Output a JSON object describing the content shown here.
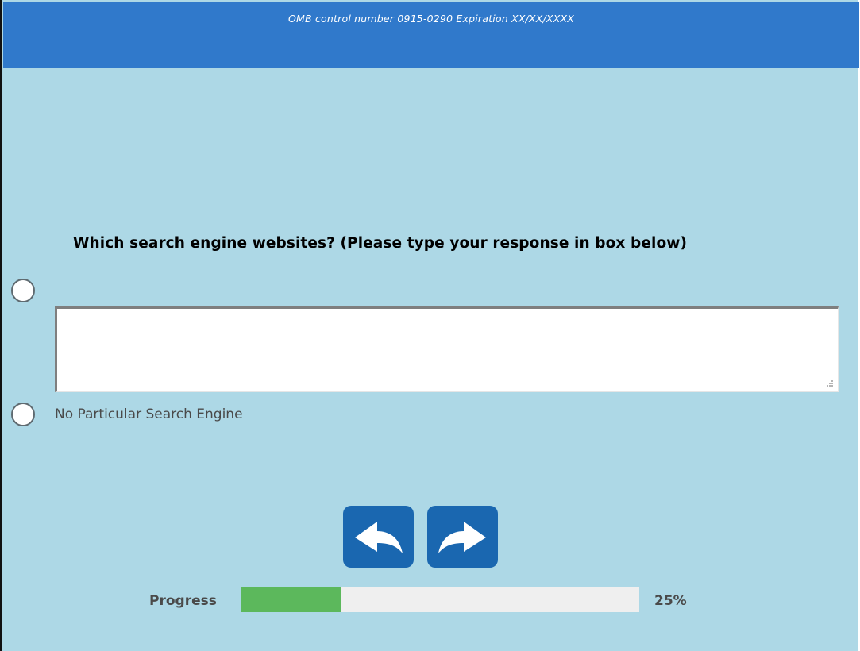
{
  "header": {
    "omb_text": "OMB control number 0915-0290 Expiration XX/XX/XXXX",
    "background_color": "#3079cb"
  },
  "question": {
    "text": "Which search engine websites? (Please type your response in box below)"
  },
  "options": [
    {
      "type": "radio-with-textbox",
      "selected": false,
      "textbox_value": "",
      "textbox_placeholder": ""
    },
    {
      "type": "radio",
      "label": "No Particular Search Engine",
      "selected": false
    }
  ],
  "navigation": {
    "back_icon": "back-arrow-icon",
    "next_icon": "forward-arrow-icon",
    "button_color": "#1a67b0"
  },
  "progress": {
    "label": "Progress",
    "percent_text": "25%",
    "fraction": 0.25,
    "fill_color": "#5cb85c"
  },
  "colors": {
    "page_background": "#add8e6"
  }
}
